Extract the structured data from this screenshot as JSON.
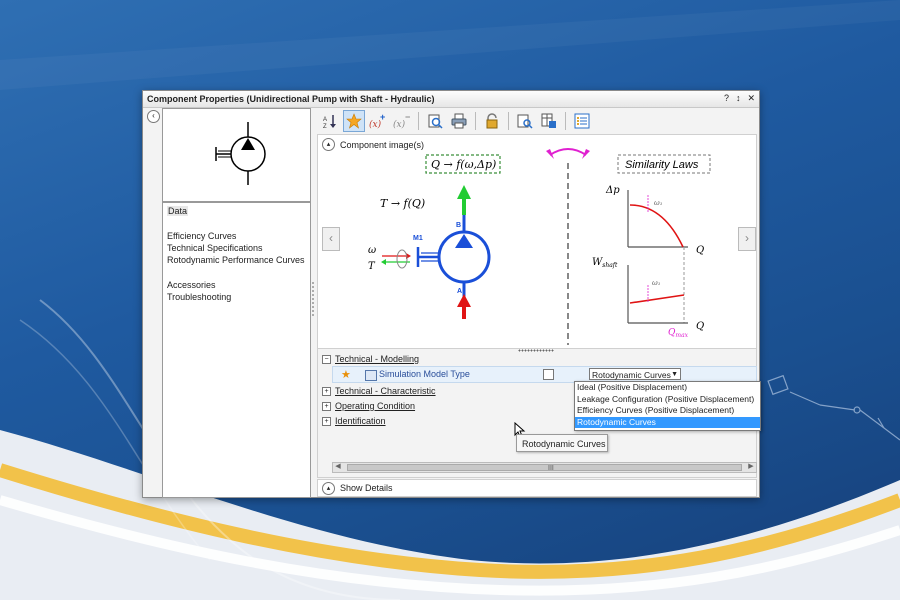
{
  "window": {
    "title": "Component Properties (Unidirectional Pump with Shaft - Hydraulic)",
    "controls": [
      "?",
      "↕",
      "✕"
    ]
  },
  "left_panel": {
    "data_header": "Data",
    "items": [
      "Efficiency Curves",
      "Technical Specifications",
      "Rotodynamic Performance Curves",
      "Accessories",
      "Troubleshooting"
    ]
  },
  "images": {
    "header": "Component image(s)",
    "schematic": {
      "top_formula": "Q → f(ω,Δp)",
      "t_formula": "T → f(Q)",
      "omega": "ω",
      "t_label": "T",
      "m1": "M1",
      "port_b": "B",
      "port_a": "A",
      "similarity": "Similarity Laws",
      "dp": "Δp",
      "q": "Q",
      "omega1": "ω₁",
      "wshaft": "W",
      "wshaft_sub": "shaft",
      "qmax": "Q",
      "qmax_sub": "max"
    }
  },
  "properties": {
    "sections": [
      {
        "label": "Technical - Modelling",
        "state": "−"
      },
      {
        "label": "Technical - Characteristic",
        "state": "+"
      },
      {
        "label": "Operating Condition",
        "state": "+"
      },
      {
        "label": "Identification",
        "state": "+"
      }
    ],
    "row": {
      "name": "Simulation Model Type",
      "value": "Rotodynamic Curves"
    },
    "dropdown_options": [
      "Ideal (Positive Displacement)",
      "Leakage Configuration (Positive Displacement)",
      "Efficiency Curves (Positive Displacement)",
      "Rotodynamic Curves"
    ],
    "tooltip": "Rotodynamic Curves",
    "scroll_grip": "III"
  },
  "details": {
    "label": "Show Details"
  },
  "colors": {
    "accent_blue": "#1a4fd8",
    "green": "#22cc33",
    "red": "#e01414",
    "magenta": "#e020d0",
    "selection": "#3399ff"
  }
}
